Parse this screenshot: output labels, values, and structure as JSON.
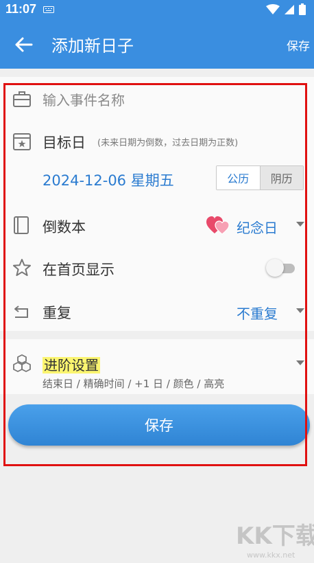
{
  "status_bar": {
    "time": "11:07"
  },
  "app_bar": {
    "title": "添加新日子",
    "save_label": "保存"
  },
  "form": {
    "event_name": {
      "placeholder": "输入事件名称",
      "value": ""
    },
    "target_day": {
      "label": "目标日",
      "hint": "(未来日期为倒数，过去日期为正数)",
      "date_value": "2024-12-06 星期五",
      "calendar_options": [
        "公历",
        "阴历"
      ],
      "selected_calendar": "公历"
    },
    "book": {
      "label": "倒数本",
      "value": "纪念日",
      "icon": "hearts-icon"
    },
    "show_on_home": {
      "label": "在首页显示",
      "toggle_on": false
    },
    "repeat": {
      "label": "重复",
      "value": "不重复"
    }
  },
  "advanced": {
    "title": "进阶设置",
    "subtitle": "结束日 / 精确时间 / +1 日 / 颜色 / 高亮"
  },
  "save_button": {
    "label": "保存"
  },
  "watermark": {
    "text": "KK下载",
    "url_text": "www.kkx.net"
  },
  "colors": {
    "primary": "#3a8ee0",
    "accent_text": "#2a7bd0",
    "highlight": "#fbf570",
    "annotation_frame": "#e01010"
  }
}
